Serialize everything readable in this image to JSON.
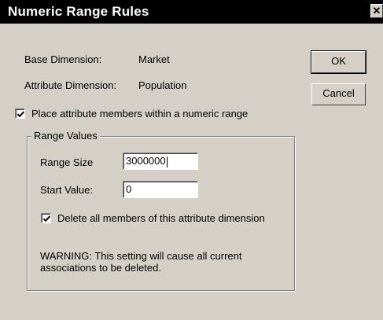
{
  "window": {
    "title": "Numeric Range Rules",
    "close_symbol": "✕"
  },
  "fields": {
    "base_dimension_label": "Base Dimension:",
    "base_dimension_value": "Market",
    "attribute_dimension_label": "Attribute Dimension:",
    "attribute_dimension_value": "Population"
  },
  "options": {
    "place_within_range_label": "Place attribute members within a numeric range",
    "place_within_range_checked": true
  },
  "range_values": {
    "group_title": "Range Values",
    "range_size_label": "Range Size",
    "range_size_value": "3000000",
    "start_value_label": "Start Value:",
    "start_value_value": "0",
    "delete_members_label": "Delete all members of this attribute dimension",
    "delete_members_checked": true,
    "warning_line1": "WARNING: This setting will cause all current",
    "warning_line2": "associations to be deleted."
  },
  "buttons": {
    "ok_label": "OK",
    "cancel_label": "Cancel"
  }
}
